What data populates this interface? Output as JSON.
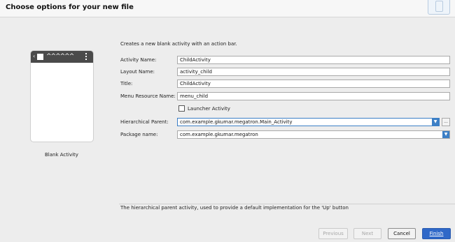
{
  "header": {
    "title": "Choose options for your new file",
    "icon": "new-file-icon"
  },
  "preview": {
    "back_glyph": "‹",
    "app_title_glyph": "^^^^^^",
    "template_name": "Blank Activity"
  },
  "form": {
    "description": "Creates a new blank activity with an action bar.",
    "activity_name": {
      "label": "Activity Name:",
      "value": "ChildActivity"
    },
    "layout_name": {
      "label": "Layout Name:",
      "value": "activity_child"
    },
    "title": {
      "label": "Title:",
      "value": "ChildActivity"
    },
    "menu_resource_name": {
      "label": "Menu Resource Name:",
      "value": "menu_child"
    },
    "launcher_activity": {
      "label": "Launcher Activity",
      "checked": false
    },
    "hierarchical_parent": {
      "label": "Hierarchical Parent:",
      "value": "com.example.gkumar.megatron.Main_Activity",
      "dropdown_glyph": "▼",
      "browse_glyph": "..."
    },
    "package_name": {
      "label": "Package name:",
      "value": "com.example.gkumar.megatron",
      "dropdown_glyph": "▼"
    }
  },
  "hint": "The hierarchical parent activity, used to provide a default implementation for the 'Up' button",
  "buttons": {
    "previous": "Previous",
    "next": "Next",
    "cancel": "Cancel",
    "finish": "Finish"
  },
  "colors": {
    "accent": "#2f68c8",
    "focus_border": "#3c7fc6",
    "background": "#ededed"
  }
}
